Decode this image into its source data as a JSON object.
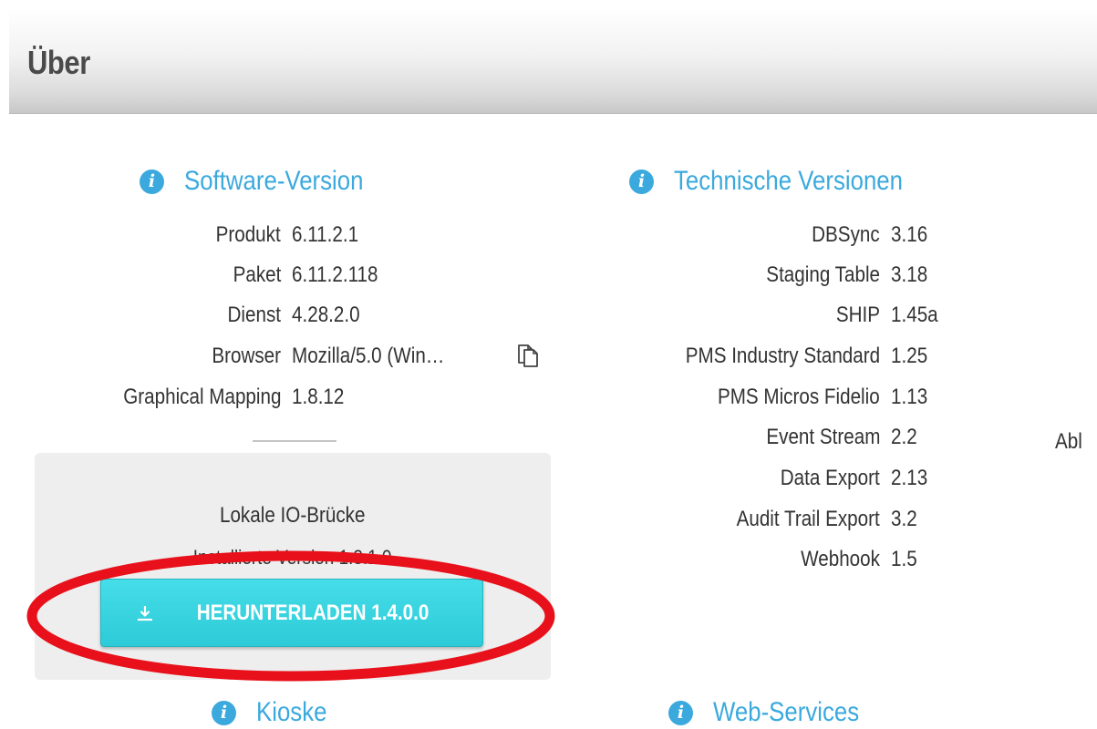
{
  "header": {
    "title": "Über"
  },
  "software_version": {
    "title": "Software-Version",
    "rows": [
      {
        "label": "Produkt",
        "value": "6.11.2.1"
      },
      {
        "label": "Paket",
        "value": "6.11.2.118"
      },
      {
        "label": "Dienst",
        "value": "4.28.2.0"
      },
      {
        "label": "Browser",
        "value": "Mozilla/5.0 (Win…"
      },
      {
        "label": "Graphical Mapping",
        "value": "1.8.12"
      }
    ]
  },
  "local_io_bridge": {
    "title": "Lokale IO-Brücke",
    "installed_version": "Installierte Version 1.3.1.0",
    "download_button": "HERUNTERLADEN 1.4.0.0"
  },
  "technical_versions": {
    "title": "Technische Versionen",
    "rows": [
      {
        "label": "DBSync",
        "value": "3.16"
      },
      {
        "label": "Staging Table",
        "value": "3.18"
      },
      {
        "label": "SHIP",
        "value": "1.45a"
      },
      {
        "label": "PMS Industry Standard",
        "value": "1.25"
      },
      {
        "label": "PMS Micros Fidelio",
        "value": "1.13"
      },
      {
        "label": "Event Stream",
        "value": "2.2"
      },
      {
        "label": "Data Export",
        "value": "2.13"
      },
      {
        "label": "Audit Trail Export",
        "value": "3.2"
      },
      {
        "label": "Webhook",
        "value": "1.5"
      }
    ]
  },
  "right_cut_text": "Abl",
  "kiosks": {
    "title": "Kioske"
  },
  "web_services": {
    "title": "Web-Services"
  },
  "colors": {
    "accent": "#3ba9dd",
    "button": "#2dcbd8",
    "annotation": "#e8101a"
  },
  "icons": {
    "info": "info-circle-icon",
    "copy": "copy-icon",
    "download": "download-icon"
  }
}
